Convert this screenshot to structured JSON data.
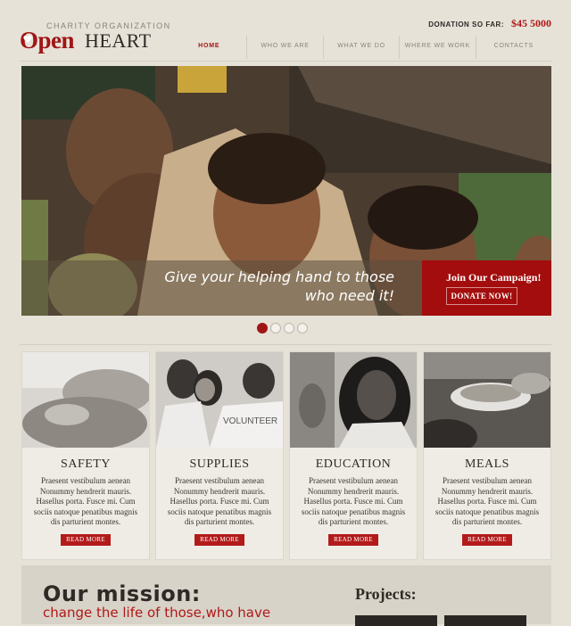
{
  "header": {
    "logo_tagline": "CHARITY ORGANIZATION",
    "logo_open": "Open",
    "logo_heart": "HEART",
    "donation_label": "DONATION SO FAR:",
    "donation_amount": "$45 5000"
  },
  "nav": {
    "items": [
      {
        "label": "HOME",
        "active": true
      },
      {
        "label": "WHO WE ARE",
        "active": false
      },
      {
        "label": "WHAT WE DO",
        "active": false
      },
      {
        "label": "WHERE WE WORK",
        "active": false
      },
      {
        "label": "CONTACTS",
        "active": false
      }
    ]
  },
  "hero": {
    "caption_line1": "Give your helping hand to those",
    "caption_line2": "who need it!",
    "campaign_title": "Join Our Campaign!",
    "donate_label": "DONATE NOW!",
    "slides": 4,
    "active_slide": 1
  },
  "cards": [
    {
      "title": "SAFETY",
      "text": "Praesent vestibulum aenean Nonummy hendrerit mauris. Hasellus porta. Fusce mi. Cum sociis natoque penatibus magnis dis parturient montes.",
      "button": "READ MORE",
      "image": "hands-photo"
    },
    {
      "title": "SUPPLIES",
      "text": "Praesent vestibulum aenean Nonummy hendrerit mauris. Hasellus porta. Fusce mi. Cum sociis natoque penatibus magnis dis parturient montes.",
      "button": "READ MORE",
      "image": "volunteers-photo"
    },
    {
      "title": "EDUCATION",
      "text": "Praesent vestibulum aenean Nonummy hendrerit mauris. Hasellus porta. Fusce mi. Cum sociis natoque penatibus magnis dis parturient montes.",
      "button": "READ MORE",
      "image": "girl-photo"
    },
    {
      "title": "MEALS",
      "text": "Praesent vestibulum aenean Nonummy hendrerit mauris. Hasellus porta. Fusce mi. Cum sociis natoque penatibus magnis dis parturient montes.",
      "button": "READ MORE",
      "image": "food-plate-photo"
    }
  ],
  "mission": {
    "title": "Our mission:",
    "subtitle": "change the life of those,who have"
  },
  "projects": {
    "title": "Projects:"
  },
  "colors": {
    "brand_red": "#a01616",
    "background": "#e6e2d8",
    "text_dark": "#2e2a26"
  }
}
